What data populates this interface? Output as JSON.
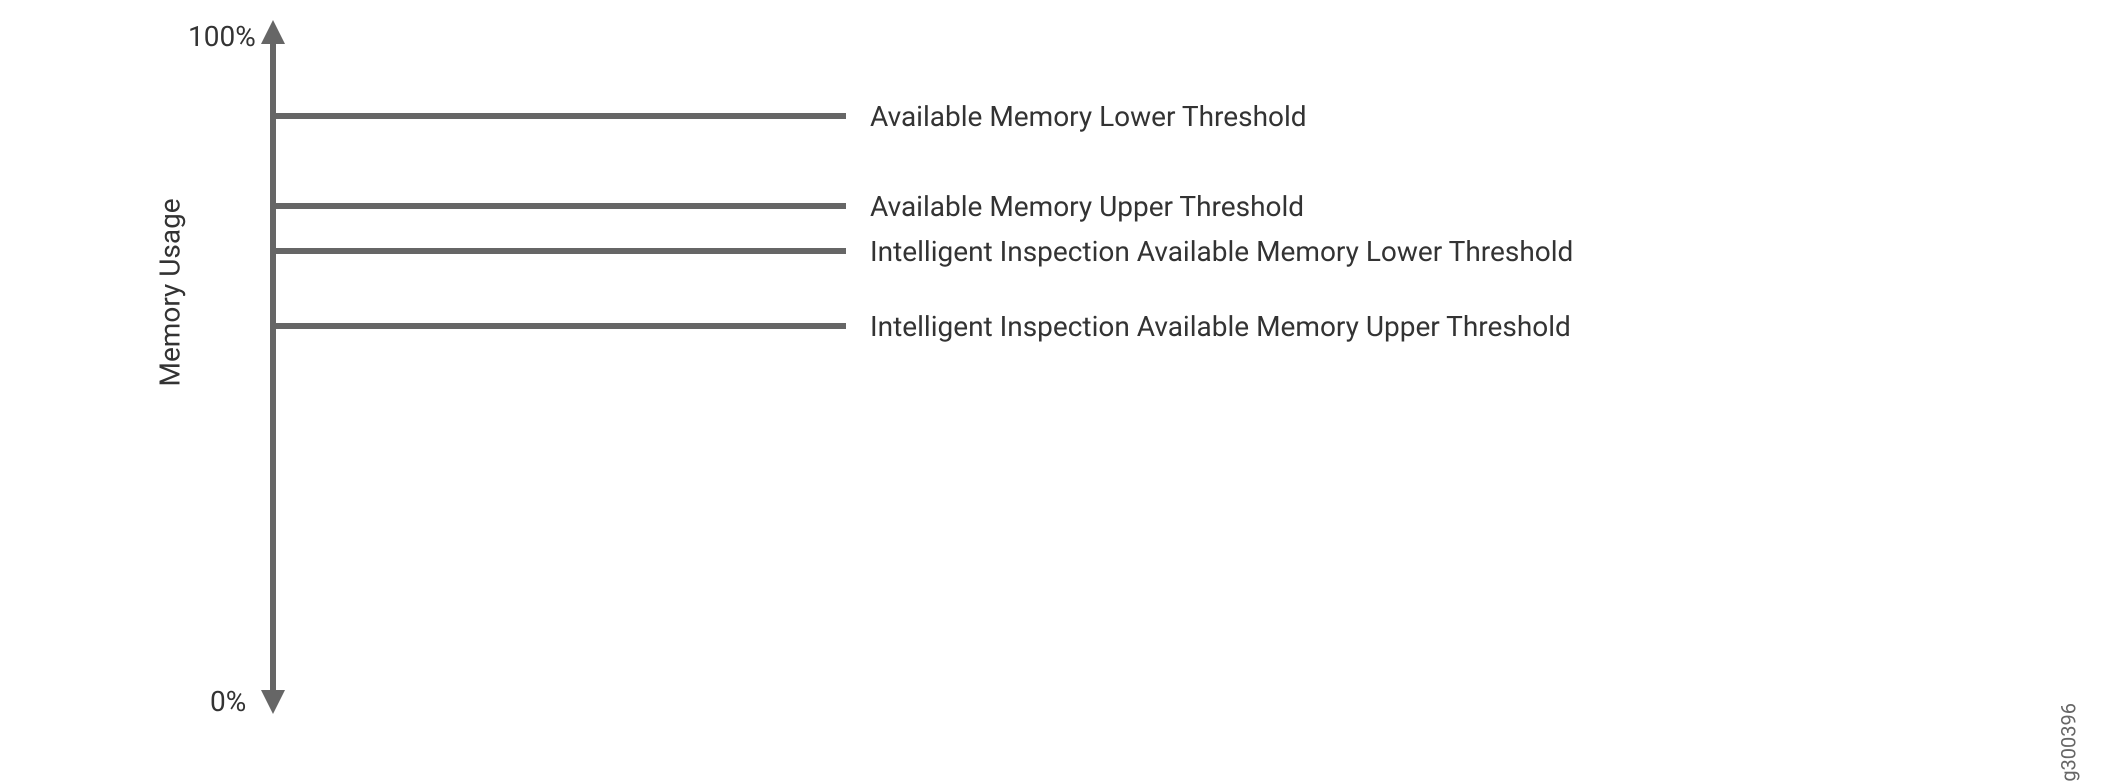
{
  "axis": {
    "label": "Memory Usage",
    "top_value": "100%",
    "bottom_value": "0%"
  },
  "thresholds": {
    "t1": "Available Memory Lower Threshold",
    "t2": "Available Memory Upper Threshold",
    "t3": "Intelligent Inspection Available Memory Lower Threshold",
    "t4": "Intelligent Inspection Available Memory Upper Threshold"
  },
  "image_id": "g300396"
}
